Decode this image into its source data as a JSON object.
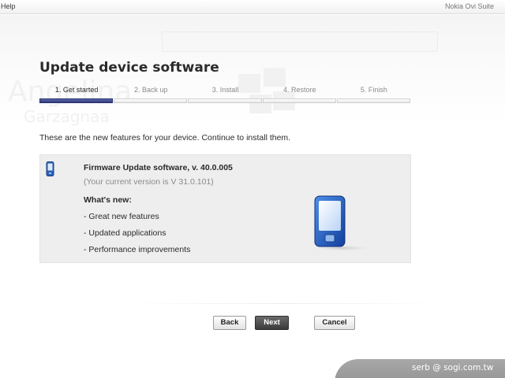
{
  "menu": {
    "help_label": "Help"
  },
  "app": {
    "title": "Nokia Ovi Suite"
  },
  "background": {
    "ghost_word": "Angelina",
    "ghost_word2": "Garzagnaa"
  },
  "page": {
    "title": "Update device software"
  },
  "steps": [
    {
      "label": "1. Get started",
      "active": true
    },
    {
      "label": "2. Back up",
      "active": false
    },
    {
      "label": "3. Install",
      "active": false
    },
    {
      "label": "4. Restore",
      "active": false
    },
    {
      "label": "5. Finish",
      "active": false
    }
  ],
  "intro": "These are the new features for your device. Continue to install them.",
  "firmware": {
    "title": "Firmware Update software, v. 40.0.005",
    "current_version": "(Your current version is V 31.0.101)",
    "whats_new_label": "What's new:",
    "features": [
      "- Great new features",
      "- Updated applications",
      "- Performance improvements"
    ]
  },
  "buttons": {
    "back": "Back",
    "next": "Next",
    "cancel": "Cancel"
  },
  "watermark": "serb  @ sogi.com.tw",
  "icons": {
    "small_phone": "mobile-phone-icon",
    "large_phone": "mobile-phone-icon"
  },
  "colors": {
    "accent": "#2e3a7e",
    "phone_blue": "#1f5fbf"
  }
}
